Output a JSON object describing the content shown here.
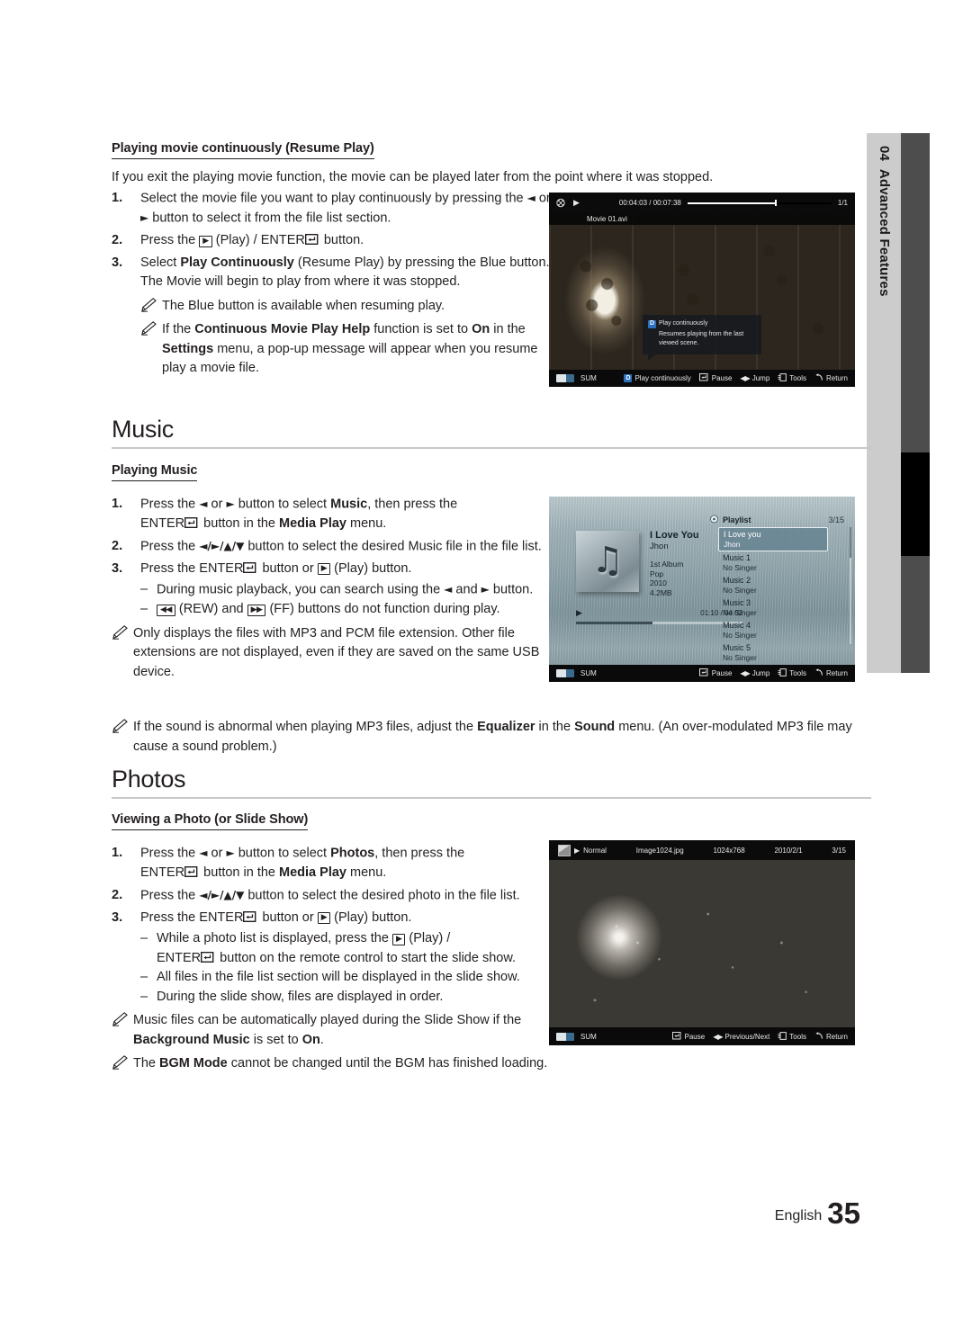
{
  "chapter_tab": {
    "number": "04",
    "label": "Advanced Features"
  },
  "footer": {
    "language": "English",
    "page": "35"
  },
  "resume": {
    "heading": "Playing movie continuously (Resume Play)",
    "intro": "If you exit the playing movie function, the movie can be played later from the point where it was stopped.",
    "step1_a": "Select the movie file you want to play continuously by pressing the ",
    "step1_b": " or ",
    "step1_c": " button to select it from the file list section.",
    "step2_a": "Press the ",
    "step2_play": "(Play) / ",
    "step2_enter": "ENTER",
    "step2_b": " button.",
    "step3_a": "Select ",
    "step3_bold": "Play Continuously",
    "step3_b": " (Resume Play) by pressing the Blue button. The Movie will begin to play from where it was stopped.",
    "note1": "The Blue button is available when resuming play.",
    "note2_a": "If the ",
    "note2_bold1": "Continuous Movie Play Help",
    "note2_b": " function is set to ",
    "note2_bold2": "On",
    "note2_c": " in the ",
    "note2_bold3": "Settings",
    "note2_d": " menu, a pop-up message will appear when you resume play a movie file.",
    "numbers": [
      "1.",
      "2.",
      "3."
    ]
  },
  "music_section": {
    "title": "Music",
    "heading": "Playing Music",
    "step1_a": "Press the ",
    "step1_b": " or ",
    "step1_c": " button to select ",
    "step1_bold": "Music",
    "step1_d": ", then press the ",
    "step1_enter": "ENTER",
    "step1_e": " button in the ",
    "step1_bold2": "Media Play",
    "step1_f": " menu.",
    "step2_a": "Press the ",
    "step2_arrows": "◄/►/▲/▼",
    "step2_b": " button to select the desired Music file in the file list.",
    "step3_a": "Press the ",
    "step3_enter": "ENTER",
    "step3_b": " button or ",
    "step3_c": " (Play) button.",
    "dash1_a": "During music playback, you can search using the ",
    "dash1_b": " and ",
    "dash1_c": " button.",
    "dash2_a": " (REW) and ",
    "dash2_b": " (FF) buttons do not function during play.",
    "note1": "Only displays the files with MP3 and PCM file extension. Other file extensions are not displayed, even if they are saved on the same USB device.",
    "note2_a": "If the sound is abnormal when playing MP3 files, adjust the ",
    "note2_bold1": "Equalizer",
    "note2_b": " in the ",
    "note2_bold2": "Sound",
    "note2_c": " menu. (An over-modulated MP3 file may cause a sound problem.)",
    "numbers": [
      "1.",
      "2.",
      "3."
    ]
  },
  "photos_section": {
    "title": "Photos",
    "heading": "Viewing a Photo (or Slide Show)",
    "step1_a": "Press the ",
    "step1_b": " or ",
    "step1_c": " button to select ",
    "step1_bold": "Photos",
    "step1_d": ", then press the ",
    "step1_enter": "ENTER",
    "step1_e": " button in the ",
    "step1_bold2": "Media Play",
    "step1_f": " menu.",
    "step2_a": "Press the ",
    "step2_arrows": "◄/►/▲/▼",
    "step2_b": " button to select the desired photo in the file list.",
    "step3_a": "Press the ",
    "step3_enter": "ENTER",
    "step3_b": " button or ",
    "step3_c": " (Play) button.",
    "dash1_a": "While a photo list is displayed, press the ",
    "dash1_b": " (Play) / ",
    "dash1_enter": "ENTER",
    "dash1_c": " button on the remote control to start the slide show.",
    "dash2": "All files in the file list section will be displayed in the slide show.",
    "dash3": "During the slide show, files are displayed in order.",
    "note1_a": "Music files can be automatically played during the Slide Show if the ",
    "note1_bold": "Background Music",
    "note1_b": " is set to ",
    "note1_bold2": "On",
    "note1_c": ".",
    "note2_a": "The ",
    "note2_bold": "BGM Mode",
    "note2_b": " cannot be changed until the BGM has finished loading.",
    "numbers": [
      "1.",
      "2.",
      "3."
    ]
  },
  "movie_shot": {
    "play_icon": "play-icon",
    "film_icon": "film-reel-icon",
    "time": "00:04:03 / 00:07:38",
    "page_count": "1/1",
    "filename": "Movie 01.avi",
    "popup_title": "Play continuously",
    "popup_body": "Resumes playing from the last viewed scene.",
    "popup_badge": "D",
    "source_label": "SUM",
    "bottom": [
      {
        "badge": "D",
        "label": "Play continuously"
      },
      {
        "icon": "enter-icon",
        "label": "Pause"
      },
      {
        "icon": "left-right-icon",
        "label": "Jump"
      },
      {
        "icon": "tools-icon",
        "label": "Tools"
      },
      {
        "icon": "return-icon",
        "label": "Return"
      }
    ]
  },
  "music_shot": {
    "playlist_label": "Playlist",
    "playlist_count": "3/15",
    "now_title": "I Love You",
    "now_artist": "Jhon",
    "meta": [
      "1st Album",
      "Pop",
      "2010",
      "4.2MB"
    ],
    "time": "01:10 / 04:02",
    "source_label": "SUM",
    "playlist": [
      {
        "title": "I Love you",
        "artist": "Jhon",
        "selected": true
      },
      {
        "title": "Music 1",
        "artist": "No Singer",
        "selected": false
      },
      {
        "title": "Music 2",
        "artist": "No Singer",
        "selected": false
      },
      {
        "title": "Music 3",
        "artist": "No Singer",
        "selected": false
      },
      {
        "title": "Music 4",
        "artist": "No Singer",
        "selected": false
      },
      {
        "title": "Music 5",
        "artist": "No Singer",
        "selected": false
      }
    ],
    "bottom": [
      {
        "icon": "enter-icon",
        "label": "Pause"
      },
      {
        "icon": "left-right-icon",
        "label": "Jump"
      },
      {
        "icon": "tools-icon",
        "label": "Tools"
      },
      {
        "icon": "return-icon",
        "label": "Return"
      }
    ]
  },
  "photo_shot": {
    "mode": "Normal",
    "filename": "Image1024.jpg",
    "resolution": "1024x768",
    "date": "2010/2/1",
    "index": "3/15",
    "source_label": "SUM",
    "bottom": [
      {
        "icon": "enter-icon",
        "label": "Pause"
      },
      {
        "icon": "left-right-icon",
        "label": "Previous/Next"
      },
      {
        "icon": "tools-icon",
        "label": "Tools"
      },
      {
        "icon": "return-icon",
        "label": "Return"
      }
    ]
  }
}
